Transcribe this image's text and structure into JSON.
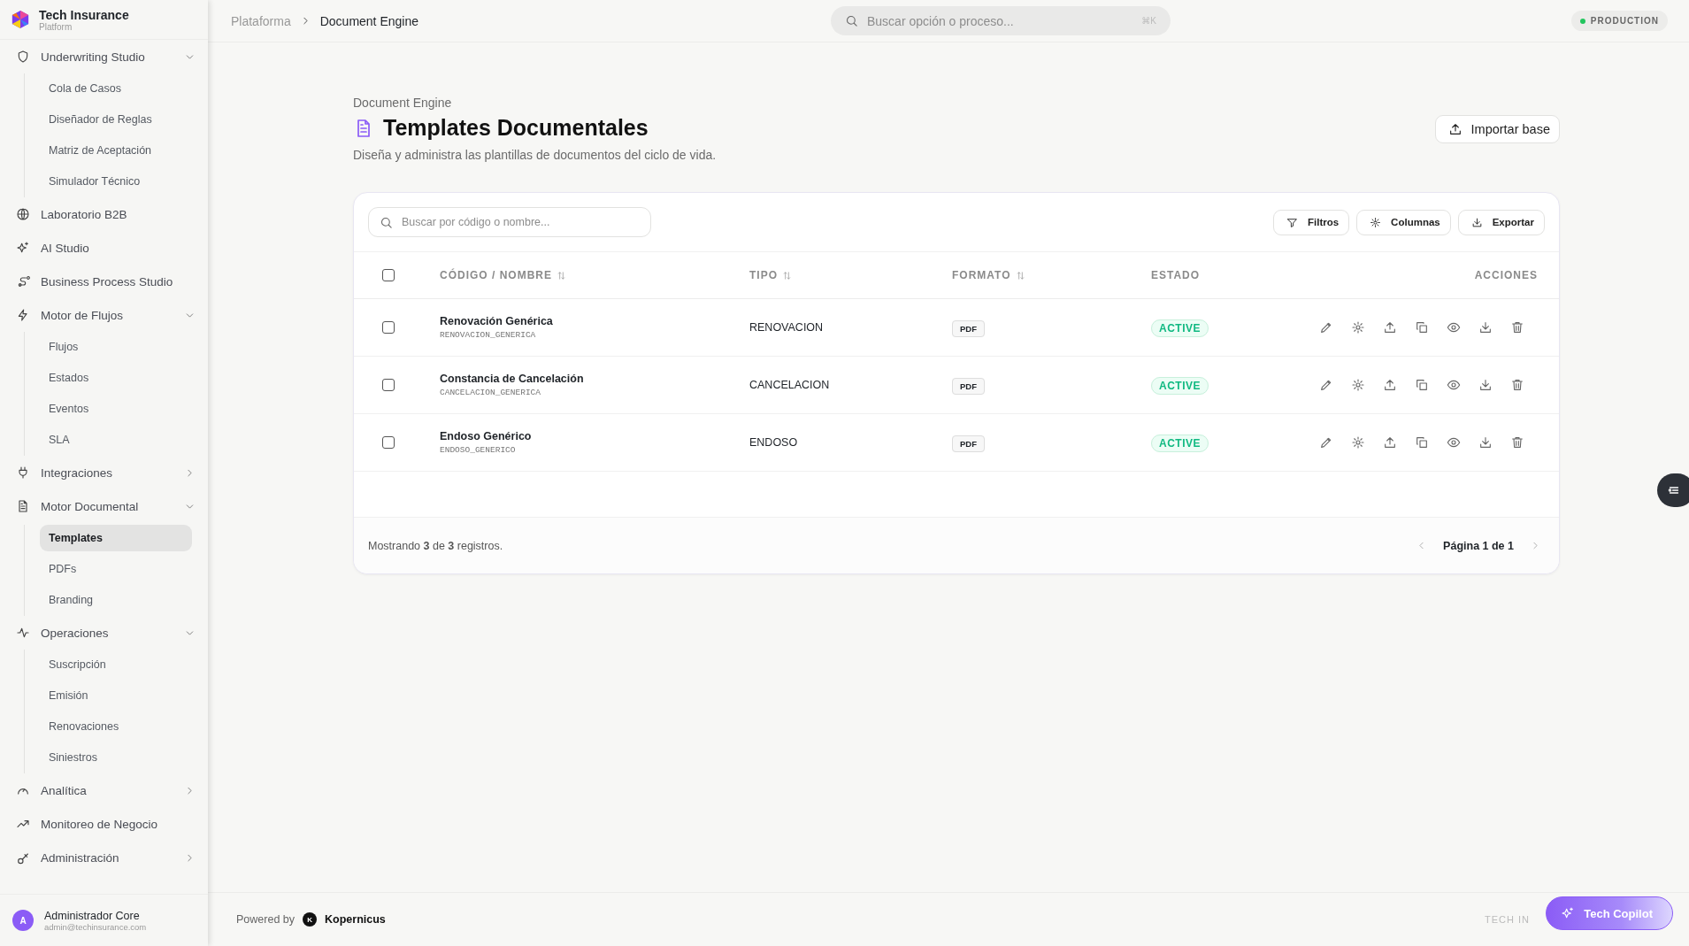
{
  "brand": {
    "name": "Tech Insurance",
    "sub": "Platform"
  },
  "sidebar": {
    "items": [
      {
        "kind": "group",
        "label": "Underwriting Studio",
        "expanded": true,
        "children": [
          {
            "label": "Cola de Casos",
            "selected": false
          },
          {
            "label": "Diseñador de Reglas",
            "selected": false
          },
          {
            "label": "Matriz de Aceptación",
            "selected": false
          },
          {
            "label": "Simulador Técnico",
            "selected": false
          }
        ]
      },
      {
        "kind": "link",
        "label": "Laboratorio B2B"
      },
      {
        "kind": "link",
        "label": "AI Studio"
      },
      {
        "kind": "link",
        "label": "Business Process Studio"
      },
      {
        "kind": "group",
        "label": "Motor de Flujos",
        "expanded": true,
        "children": [
          {
            "label": "Flujos",
            "selected": false
          },
          {
            "label": "Estados",
            "selected": false
          },
          {
            "label": "Eventos",
            "selected": false
          },
          {
            "label": "SLA",
            "selected": false
          }
        ]
      },
      {
        "kind": "group",
        "label": "Integraciones",
        "expanded": false
      },
      {
        "kind": "group",
        "label": "Motor Documental",
        "expanded": true,
        "children": [
          {
            "label": "Templates",
            "selected": true
          },
          {
            "label": "PDFs",
            "selected": false
          },
          {
            "label": "Branding",
            "selected": false
          }
        ]
      },
      {
        "kind": "group",
        "label": "Operaciones",
        "expanded": true,
        "children": [
          {
            "label": "Suscripción",
            "selected": false
          },
          {
            "label": "Emisión",
            "selected": false
          },
          {
            "label": "Renovaciones",
            "selected": false
          },
          {
            "label": "Siniestros",
            "selected": false
          }
        ]
      },
      {
        "kind": "group",
        "label": "Analítica",
        "expanded": false
      },
      {
        "kind": "link",
        "label": "Monitoreo de Negocio"
      },
      {
        "kind": "group",
        "label": "Administración",
        "expanded": false
      }
    ]
  },
  "user": {
    "initial": "A",
    "name": "Administrador Core",
    "email": "admin@techinsurance.com"
  },
  "topbar": {
    "breadcrumb": [
      "Plataforma",
      "Document Engine"
    ],
    "search": {
      "placeholder": "Buscar opción o proceso...",
      "shortcut": "⌘K"
    },
    "environment": "PRODUCTION"
  },
  "page": {
    "eyebrow": "Document Engine",
    "title": "Templates Documentales",
    "subtitle": "Diseña y administra las plantillas de documentos del ciclo de vida.",
    "import_button": "Importar base"
  },
  "table": {
    "search": {
      "placeholder": "Buscar por código o nombre..."
    },
    "tools": [
      "Filtros",
      "Columnas",
      "Exportar"
    ],
    "select_all": {
      "checked": false
    },
    "columns": [
      {
        "label": "CÓDIGO / NOMBRE",
        "sortable": true
      },
      {
        "label": "TIPO",
        "sortable": true
      },
      {
        "label": "FORMATO",
        "sortable": true
      },
      {
        "label": "ESTADO",
        "sortable": false
      },
      {
        "label": "ACCIONES",
        "sortable": false
      }
    ],
    "rows": [
      {
        "checked": false,
        "name": "Renovación Genérica",
        "code": "RENOVACION_GENERICA",
        "type": "RENOVACION",
        "format": "PDF",
        "status": "ACTIVE"
      },
      {
        "checked": false,
        "name": "Constancia de Cancelación",
        "code": "CANCELACION_GENERICA",
        "type": "CANCELACION",
        "format": "PDF",
        "status": "ACTIVE"
      },
      {
        "checked": false,
        "name": "Endoso Genérico",
        "code": "ENDOSO_GENERICO",
        "type": "ENDOSO",
        "format": "PDF",
        "status": "ACTIVE"
      }
    ],
    "summary": "Mostrando **3** de **3** registros.",
    "pagination": "Página 1 de 1"
  },
  "footer": {
    "powered_by": "Powered by",
    "logo_letter": "K",
    "company": "Kopernicus",
    "right_text": "TECH IN"
  },
  "copilot_button": "Tech Copilot"
}
